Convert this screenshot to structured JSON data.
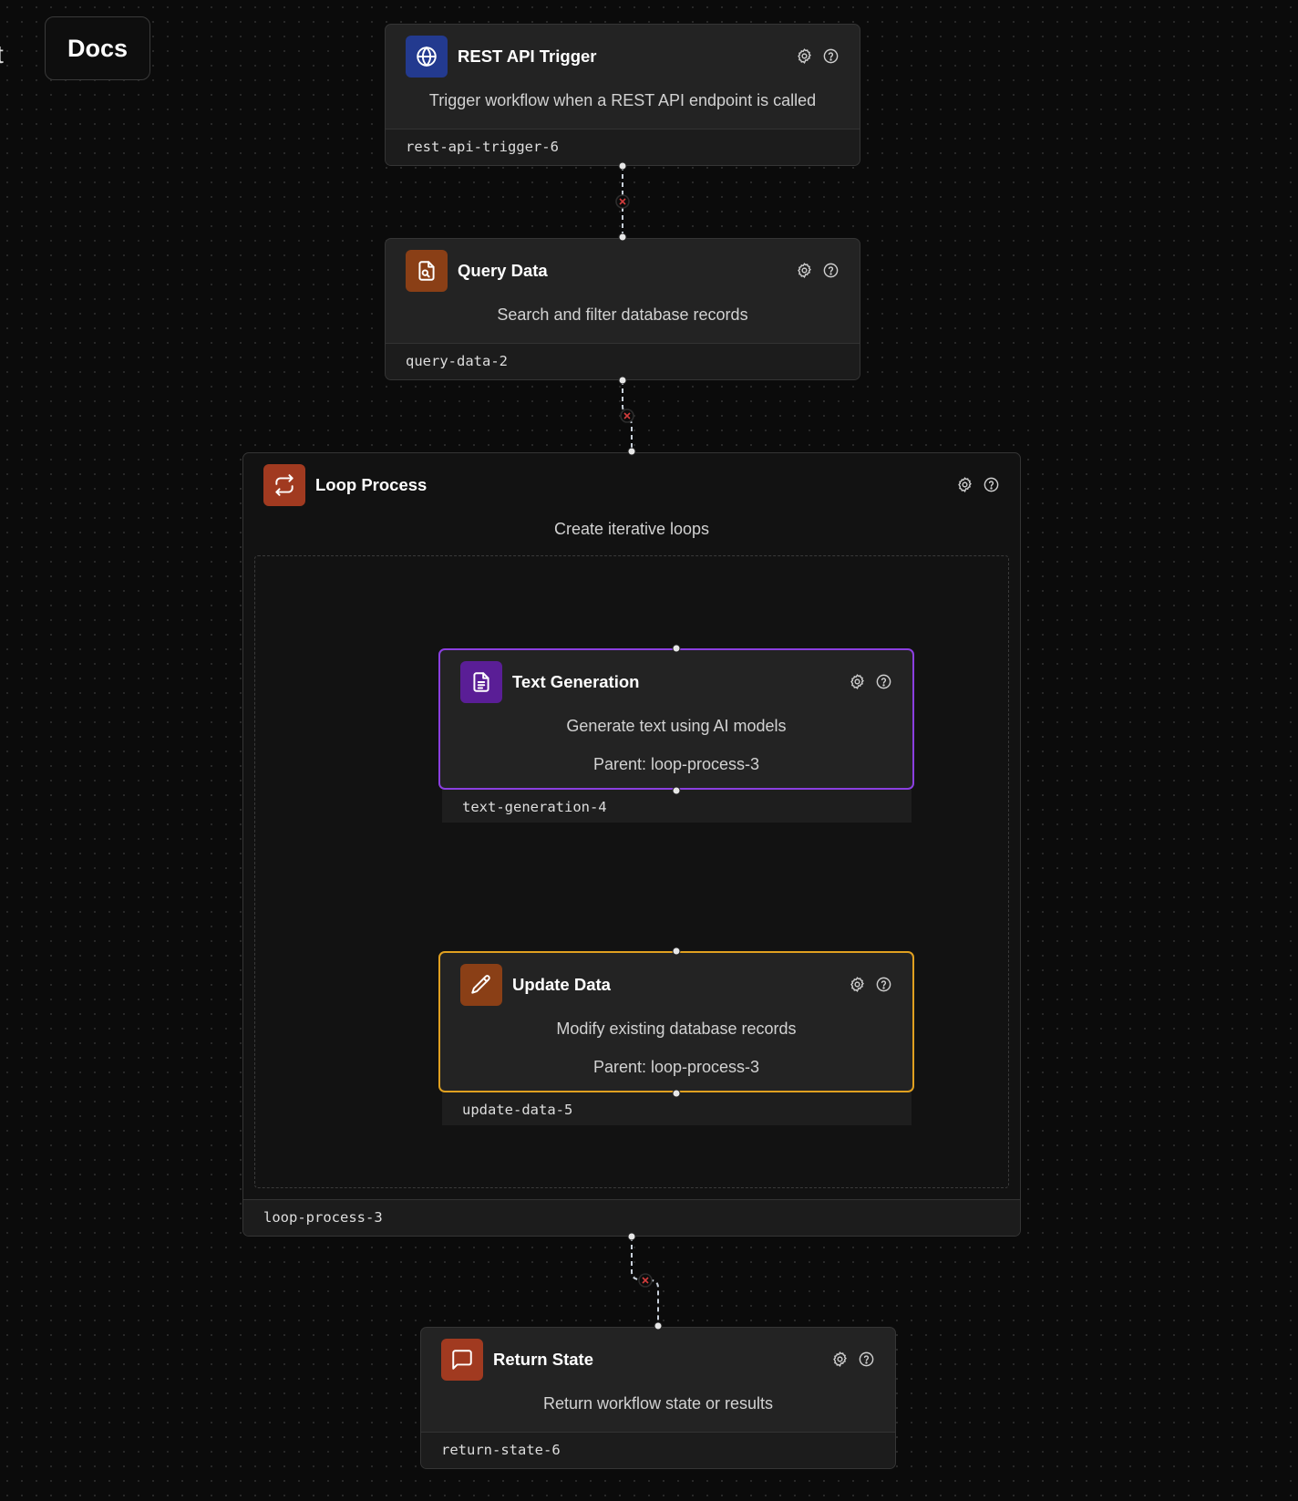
{
  "toolbar": {
    "docs_label": "Docs",
    "edge_glyph": "t"
  },
  "colors": {
    "background": "#0b0b0b",
    "trigger_icon_bg": "#233a8f",
    "query_icon_bg": "#8a3f16",
    "loop_icon_bg": "#a13a20",
    "textgen_icon_bg": "#5a1e96",
    "textgen_border": "#8b3fe0",
    "update_icon_bg": "#8a3f16",
    "update_border": "#e0a020",
    "return_icon_bg": "#a13a20",
    "edge_color": "#c8d0da",
    "edge_delete": "#d23c3c"
  },
  "nodes": {
    "trigger": {
      "icon": "globe-icon",
      "title": "REST API Trigger",
      "description": "Trigger workflow when a REST API endpoint is called",
      "id": "rest-api-trigger-6"
    },
    "query": {
      "icon": "file-search-icon",
      "title": "Query Data",
      "description": "Search and filter database records",
      "id": "query-data-2"
    },
    "loop": {
      "icon": "repeat-icon",
      "title": "Loop Process",
      "description": "Create iterative loops",
      "id": "loop-process-3"
    },
    "textgen": {
      "icon": "file-text-icon",
      "title": "Text Generation",
      "description": "Generate text using AI models",
      "parent": "Parent: loop-process-3",
      "id": "text-generation-4"
    },
    "update": {
      "icon": "pencil-icon",
      "title": "Update Data",
      "description": "Modify existing database records",
      "parent": "Parent: loop-process-3",
      "id": "update-data-5"
    },
    "return_state": {
      "icon": "message-square-icon",
      "title": "Return State",
      "description": "Return workflow state or results",
      "id": "return-state-6"
    }
  }
}
